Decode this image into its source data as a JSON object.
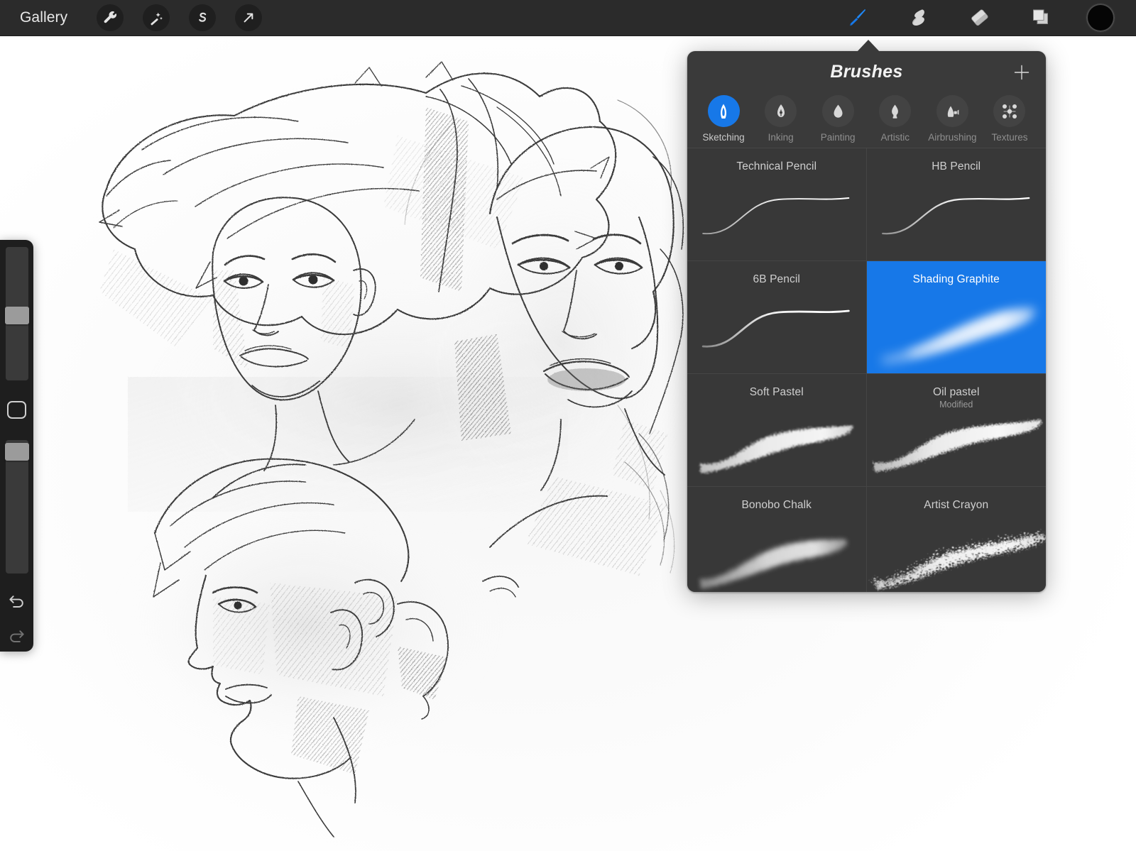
{
  "app": {
    "name": "Procreate",
    "accent_color": "#1778e8",
    "panel_bg": "#3a3a3a",
    "topbar_bg": "#2b2b2b"
  },
  "topbar": {
    "gallery_label": "Gallery",
    "left_tools": [
      {
        "name": "actions-wrench-icon",
        "label": "Actions"
      },
      {
        "name": "adjustments-wand-icon",
        "label": "Adjustments"
      },
      {
        "name": "selection-s-icon",
        "label": "Selection"
      },
      {
        "name": "transform-arrow-icon",
        "label": "Transform"
      }
    ],
    "right_tools": [
      {
        "name": "paint-brush-icon",
        "label": "Paint",
        "active": true
      },
      {
        "name": "smudge-finger-icon",
        "label": "Smudge",
        "active": false
      },
      {
        "name": "eraser-icon",
        "label": "Erase",
        "active": false
      },
      {
        "name": "layers-icon",
        "label": "Layers",
        "active": false
      }
    ],
    "color_swatch": "#050505"
  },
  "sidebar": {
    "brush_size": {
      "label": "Brush size",
      "value_pct": 57
    },
    "modify_button": {
      "label": "Modify"
    },
    "brush_opacity": {
      "label": "Brush opacity",
      "value_pct": 96
    },
    "undo": {
      "label": "Undo"
    },
    "redo": {
      "label": "Redo"
    }
  },
  "brushes_panel": {
    "title": "Brushes",
    "add_button_label": "+",
    "categories": [
      {
        "id": "sketching",
        "label": "Sketching",
        "icon": "pencil-tip-icon",
        "active": true
      },
      {
        "id": "inking",
        "label": "Inking",
        "icon": "ink-nib-icon",
        "active": false
      },
      {
        "id": "painting",
        "label": "Painting",
        "icon": "paint-drop-icon",
        "active": false
      },
      {
        "id": "artistic",
        "label": "Artistic",
        "icon": "artistic-nib-icon",
        "active": false
      },
      {
        "id": "airbrushing",
        "label": "Airbrushing",
        "icon": "airbrush-icon",
        "active": false
      },
      {
        "id": "textures",
        "label": "Textures",
        "icon": "textures-dots-icon",
        "active": false
      }
    ],
    "brushes": [
      {
        "name": "Technical Pencil",
        "subtitle": "",
        "preview": "thin-stroke",
        "selected": false
      },
      {
        "name": "HB Pencil",
        "subtitle": "",
        "preview": "thin-stroke",
        "selected": false
      },
      {
        "name": "6B Pencil",
        "subtitle": "",
        "preview": "thin-stroke",
        "selected": false
      },
      {
        "name": "Shading Graphite",
        "subtitle": "",
        "preview": "soft-graphite",
        "selected": true
      },
      {
        "name": "Soft Pastel",
        "subtitle": "",
        "preview": "pastel-texture",
        "selected": false
      },
      {
        "name": "Oil pastel",
        "subtitle": "Modified",
        "preview": "pastel-texture",
        "selected": false
      },
      {
        "name": "Bonobo Chalk",
        "subtitle": "",
        "preview": "chalk-texture",
        "selected": false
      },
      {
        "name": "Artist Crayon",
        "subtitle": "",
        "preview": "crayon-texture",
        "selected": false
      }
    ]
  },
  "canvas": {
    "artwork_description": "Pencil sketch study of three female portraits — three-quarter smiling face upper left, downward-gazing face upper right, profile head lower center"
  }
}
